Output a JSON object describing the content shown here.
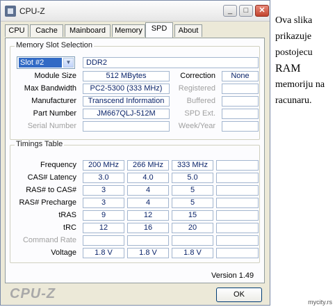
{
  "window": {
    "title": "CPU-Z",
    "buttons": {
      "minimize": "_",
      "maximize": "□",
      "close": "✕"
    }
  },
  "tabs": [
    "CPU",
    "Cache",
    "Mainboard",
    "Memory",
    "SPD",
    "About"
  ],
  "active_tab": "SPD",
  "memory_slot": {
    "legend": "Memory Slot Selection",
    "slot_selected": "Slot #2",
    "type": "DDR2",
    "rows": [
      {
        "label": "Module Size",
        "value": "512 MBytes",
        "right_label": "Correction",
        "right_value": "None"
      },
      {
        "label": "Max Bandwidth",
        "value": "PC2-5300 (333 MHz)",
        "right_label": "Registered",
        "right_value": ""
      },
      {
        "label": "Manufacturer",
        "value": "Transcend Information",
        "right_label": "Buffered",
        "right_value": ""
      },
      {
        "label": "Part Number",
        "value": "JM667QLJ-512M",
        "right_label": "SPD Ext.",
        "right_value": ""
      },
      {
        "label": "Serial Number",
        "value": "",
        "right_label": "Week/Year",
        "right_value": ""
      }
    ]
  },
  "timings": {
    "legend": "Timings Table",
    "rows": [
      {
        "label": "Frequency",
        "values": [
          "200 MHz",
          "266 MHz",
          "333 MHz",
          ""
        ]
      },
      {
        "label": "CAS# Latency",
        "values": [
          "3.0",
          "4.0",
          "5.0",
          ""
        ]
      },
      {
        "label": "RAS# to CAS#",
        "values": [
          "3",
          "4",
          "5",
          ""
        ]
      },
      {
        "label": "RAS# Precharge",
        "values": [
          "3",
          "4",
          "5",
          ""
        ]
      },
      {
        "label": "tRAS",
        "values": [
          "9",
          "12",
          "15",
          ""
        ]
      },
      {
        "label": "tRC",
        "values": [
          "12",
          "16",
          "20",
          ""
        ]
      },
      {
        "label": "Command Rate",
        "values": [
          "",
          "",
          "",
          ""
        ]
      },
      {
        "label": "Voltage",
        "values": [
          "1.8 V",
          "1.8 V",
          "1.8 V",
          ""
        ]
      }
    ]
  },
  "version": "Version 1.49",
  "brand": "CPU-Z",
  "ok_button": "OK",
  "side_note": [
    "Ova slika",
    "prikazuje",
    "postojecu",
    "RAM",
    "memoriju na",
    "racunaru."
  ],
  "watermark": "mycity.rs"
}
